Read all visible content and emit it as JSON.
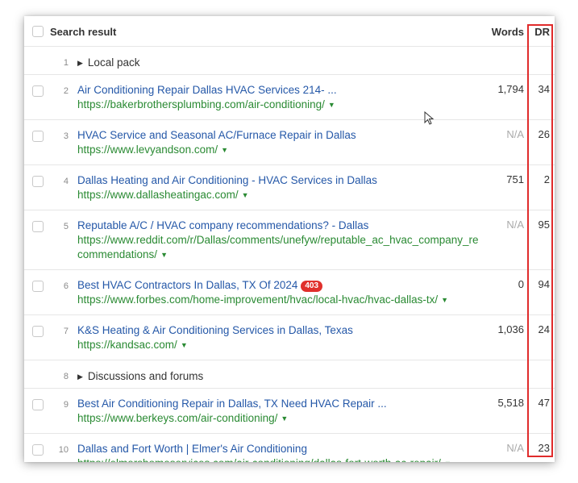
{
  "header": {
    "col_result": "Search result",
    "col_words": "Words",
    "col_dr": "DR"
  },
  "rows": [
    {
      "type": "group",
      "num": "1",
      "label": "Local pack"
    },
    {
      "type": "result",
      "num": "2",
      "title": "Air Conditioning Repair Dallas HVAC Services 214- ...",
      "url": "https://bakerbrothersplumbing.com/air-conditioning/",
      "words": "1,794",
      "dr": "34"
    },
    {
      "type": "result",
      "num": "3",
      "title": "HVAC Service and Seasonal AC/Furnace Repair in Dallas",
      "url": "https://www.levyandson.com/",
      "words": "N/A",
      "dr": "26"
    },
    {
      "type": "result",
      "num": "4",
      "title": "Dallas Heating and Air Conditioning - HVAC Services in Dallas",
      "url": "https://www.dallasheatingac.com/",
      "words": "751",
      "dr": "2"
    },
    {
      "type": "result",
      "num": "5",
      "title": "Reputable A/C / HVAC company recommendations? - Dallas",
      "url": "https://www.reddit.com/r/Dallas/comments/unefyw/reputable_ac_hvac_company_recommendations/",
      "words": "N/A",
      "dr": "95"
    },
    {
      "type": "result",
      "num": "6",
      "title": "Best HVAC Contractors In Dallas, TX Of 2024",
      "badge": "403",
      "url": "https://www.forbes.com/home-improvement/hvac/local-hvac/hvac-dallas-tx/",
      "words": "0",
      "dr": "94"
    },
    {
      "type": "result",
      "num": "7",
      "title": "K&S Heating & Air Conditioning Services in Dallas, Texas",
      "url": "https://kandsac.com/",
      "words": "1,036",
      "dr": "24"
    },
    {
      "type": "group",
      "num": "8",
      "label": "Discussions and forums"
    },
    {
      "type": "result",
      "num": "9",
      "title": "Best Air Conditioning Repair in Dallas, TX Need HVAC Repair ...",
      "url": "https://www.berkeys.com/air-conditioning/",
      "words": "5,518",
      "dr": "47"
    },
    {
      "type": "result",
      "num": "10",
      "title": "Dallas and Fort Worth | Elmer's Air Conditioning",
      "url": "https://elmershomeservices.com/air-conditioning/dallas-fort-worth-ac-repair/",
      "words": "N/A",
      "dr": "23"
    }
  ],
  "icons": {
    "expand": "triangle-right-icon",
    "dropdown": "caret-down-icon",
    "pointer": "mouse-cursor-icon"
  },
  "colors": {
    "title_link": "#2558a8",
    "url": "#2a8a33",
    "highlight": "#e02b2b",
    "badge": "#e0302c"
  }
}
